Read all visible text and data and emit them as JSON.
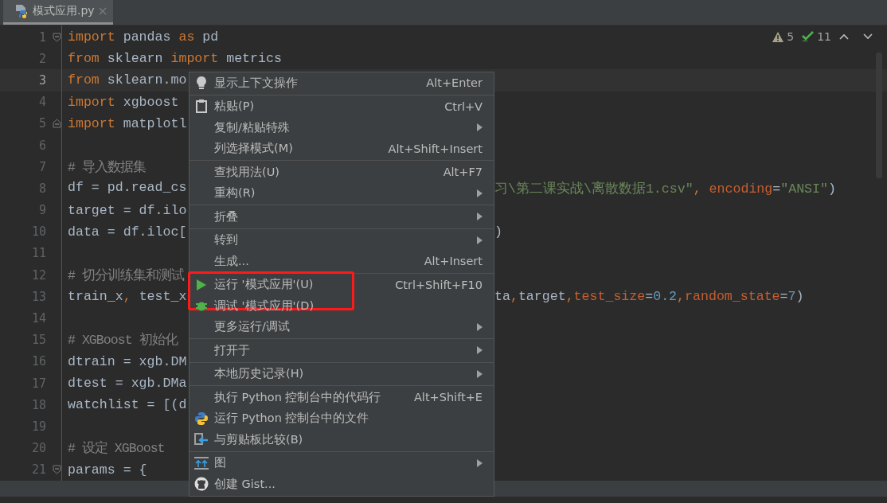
{
  "tab": {
    "title": "模式应用.py",
    "selected": true
  },
  "inspections": {
    "warnings": "5",
    "weak_warnings": "11"
  },
  "code": [
    {
      "number": "1",
      "current": false,
      "left": [
        {
          "kind": "keyword",
          "t": "import"
        },
        {
          "kind": "plain",
          "t": " pandas "
        },
        {
          "kind": "keyword",
          "t": "as"
        },
        {
          "kind": "plain",
          "t": " pd"
        }
      ]
    },
    {
      "number": "2",
      "current": false,
      "left": [
        {
          "kind": "keyword",
          "t": "from"
        },
        {
          "kind": "plain",
          "t": " sklearn "
        },
        {
          "kind": "keyword",
          "t": "import"
        },
        {
          "kind": "plain",
          "t": " metrics"
        }
      ]
    },
    {
      "number": "3",
      "current": true,
      "left": [
        {
          "kind": "keyword",
          "t": "from"
        },
        {
          "kind": "plain",
          "t": " sklearn.mo"
        }
      ]
    },
    {
      "number": "4",
      "current": false,
      "left": [
        {
          "kind": "keyword",
          "t": "import"
        },
        {
          "kind": "plain",
          "t": " xgboost"
        }
      ]
    },
    {
      "number": "5",
      "current": false,
      "left": [
        {
          "kind": "keyword",
          "t": "import"
        },
        {
          "kind": "plain",
          "t": " matplotl"
        }
      ]
    },
    {
      "number": "6",
      "current": false
    },
    {
      "number": "7",
      "current": false,
      "left": [
        {
          "kind": "comment",
          "t": "# 导入数据集"
        }
      ]
    },
    {
      "number": "8",
      "current": false,
      "left": [
        {
          "kind": "plain",
          "t": "df = pd.read_cs"
        }
      ],
      "right": [
        {
          "kind": "string",
          "t": "习\\第二课实战\\离散数据1.csv\""
        },
        {
          "kind": "keyword",
          "t": ", "
        },
        {
          "kind": "param",
          "t": "encoding"
        },
        {
          "kind": "plain",
          "t": "="
        },
        {
          "kind": "string",
          "t": "\"ANSI\""
        },
        {
          "kind": "plain",
          "t": ")"
        }
      ]
    },
    {
      "number": "9",
      "current": false,
      "left": [
        {
          "kind": "plain",
          "t": "target = df.ilo"
        }
      ]
    },
    {
      "number": "10",
      "current": false,
      "left": [
        {
          "kind": "plain",
          "t": "data = df.iloc["
        }
      ],
      "right": [
        {
          "kind": "plain",
          "t": ")"
        }
      ]
    },
    {
      "number": "11",
      "current": false
    },
    {
      "number": "12",
      "current": false,
      "left": [
        {
          "kind": "comment",
          "t": "# 切分训练集和测试"
        }
      ]
    },
    {
      "number": "13",
      "current": false,
      "left": [
        {
          "kind": "plain",
          "t": "train_x"
        },
        {
          "kind": "keyword",
          "t": ", "
        },
        {
          "kind": "plain",
          "t": "test_x"
        }
      ],
      "right": [
        {
          "kind": "plain",
          "t": "ta"
        },
        {
          "kind": "keyword",
          "t": ","
        },
        {
          "kind": "plain",
          "t": "target"
        },
        {
          "kind": "keyword",
          "t": ","
        },
        {
          "kind": "param",
          "t": "test_size"
        },
        {
          "kind": "plain",
          "t": "="
        },
        {
          "kind": "number",
          "t": "0.2"
        },
        {
          "kind": "keyword",
          "t": ","
        },
        {
          "kind": "param",
          "t": "random_state"
        },
        {
          "kind": "plain",
          "t": "="
        },
        {
          "kind": "number",
          "t": "7"
        },
        {
          "kind": "plain",
          "t": ")"
        }
      ]
    },
    {
      "number": "14",
      "current": false
    },
    {
      "number": "15",
      "current": false,
      "left": [
        {
          "kind": "comment",
          "t": "# XGBoost 初始化"
        }
      ]
    },
    {
      "number": "16",
      "current": false,
      "left": [
        {
          "kind": "plain",
          "t": "dtrain = xgb.DM"
        }
      ]
    },
    {
      "number": "17",
      "current": false,
      "left": [
        {
          "kind": "plain",
          "t": "dtest = xgb.DMa"
        }
      ]
    },
    {
      "number": "18",
      "current": false,
      "left": [
        {
          "kind": "plain",
          "t": "watchlist = [(d"
        }
      ]
    },
    {
      "number": "19",
      "current": false
    },
    {
      "number": "20",
      "current": false,
      "left": [
        {
          "kind": "comment",
          "t": "# 设定 XGBoost"
        }
      ]
    },
    {
      "number": "21",
      "current": false,
      "left": [
        {
          "kind": "plain",
          "t": "params = {"
        }
      ]
    }
  ],
  "context_menu": [
    [
      {
        "label": "显示上下文操作",
        "shortcut": "Alt+Enter"
      }
    ],
    [
      {
        "label": "粘贴(P)",
        "shortcut": "Ctrl+V"
      },
      {
        "label": "复制/粘贴特殊",
        "submenu": true
      },
      {
        "label": "列选择模式(M)",
        "shortcut": "Alt+Shift+Insert"
      }
    ],
    [
      {
        "label": "查找用法(U)",
        "shortcut": "Alt+F7"
      },
      {
        "label": "重构(R)",
        "submenu": true
      }
    ],
    [
      {
        "label": "折叠",
        "submenu": true
      }
    ],
    [
      {
        "label": "转到",
        "submenu": true
      },
      {
        "label": "生成...",
        "shortcut": "Alt+Insert"
      }
    ],
    [
      {
        "label": "运行 '模式应用'(U)",
        "shortcut": "Ctrl+Shift+F10",
        "highlighted": true
      },
      {
        "label": "调试 '模式应用'(D)"
      },
      {
        "label": "更多运行/调试",
        "submenu": true
      }
    ],
    [
      {
        "label": "打开于",
        "submenu": true
      }
    ],
    [
      {
        "label": "本地历史记录(H)",
        "submenu": true
      }
    ],
    [
      {
        "label": "执行 Python 控制台中的代码行",
        "shortcut": "Alt+Shift+E"
      },
      {
        "label": "运行 Python 控制台中的文件"
      },
      {
        "label": "与剪贴板比较(B)"
      }
    ],
    [
      {
        "label": "图",
        "submenu": true
      },
      {
        "label": "创建 Gist..."
      }
    ]
  ]
}
